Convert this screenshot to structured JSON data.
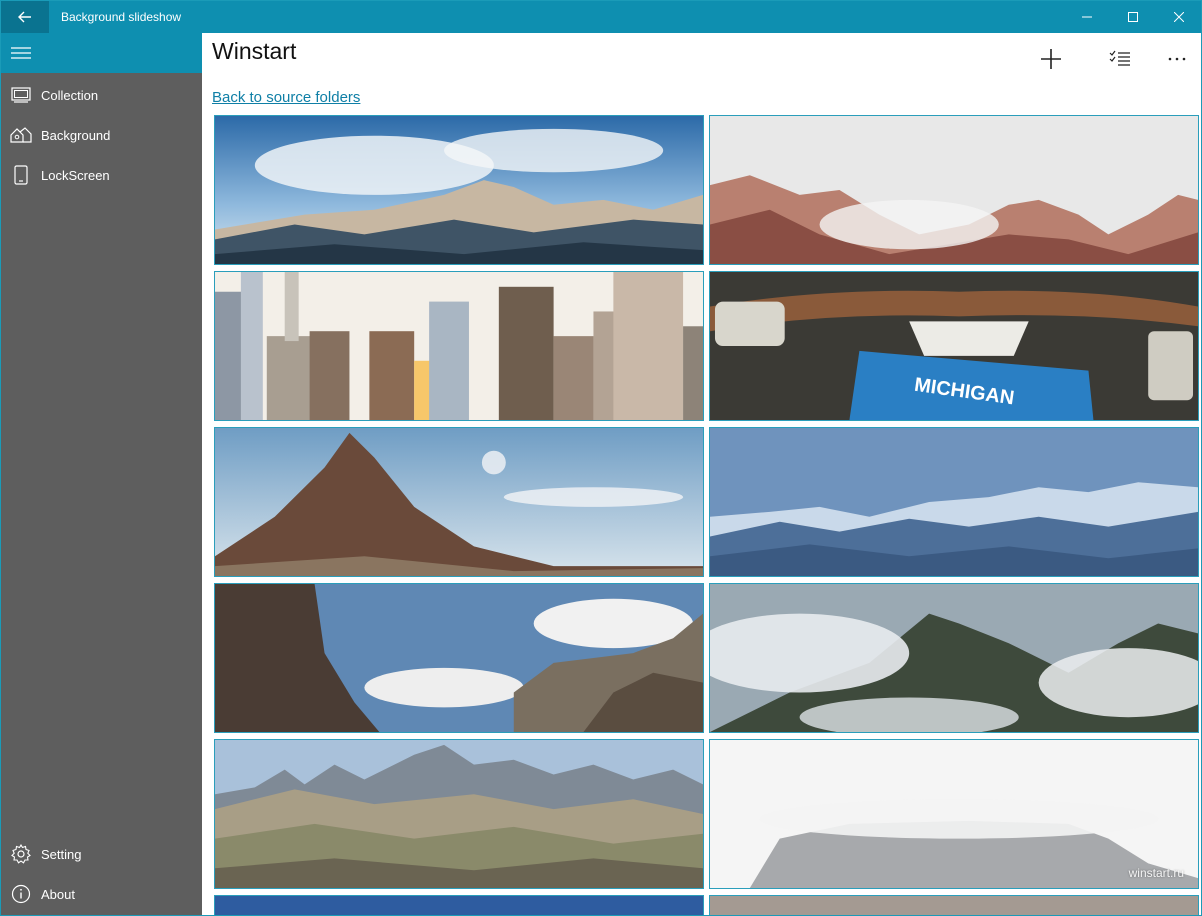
{
  "titlebar": {
    "title": "Background slideshow",
    "back_icon": "arrow-left-icon",
    "minimize_icon": "minimize-icon",
    "maximize_icon": "maximize-icon",
    "close_icon": "close-icon"
  },
  "sidebar": {
    "menu_icon": "hamburger-icon",
    "items": [
      {
        "label": "Collection",
        "icon": "collection-icon"
      },
      {
        "label": "Background",
        "icon": "background-icon"
      },
      {
        "label": "LockScreen",
        "icon": "phone-icon"
      }
    ],
    "footer_items": [
      {
        "label": "Setting",
        "icon": "gear-icon"
      },
      {
        "label": "About",
        "icon": "info-icon"
      }
    ]
  },
  "main": {
    "title": "Winstart",
    "back_link": "Back to source folders",
    "commands": [
      {
        "icon": "plus-icon"
      },
      {
        "icon": "select-list-icon"
      },
      {
        "icon": "more-icon"
      }
    ],
    "watermark": "winstart.ru",
    "images": [
      {
        "subject": "snowy mountains with blue sky and clouds"
      },
      {
        "subject": "red rock mountains in fog"
      },
      {
        "subject": "city skyscrapers at sunset"
      },
      {
        "subject": "rusty car with Michigan license plate",
        "plate_text": "MICHIGAN"
      },
      {
        "subject": "cone-shaped mountain with blue sky"
      },
      {
        "subject": "blue snowy mountain range"
      },
      {
        "subject": "rocky cliffs and clouds"
      },
      {
        "subject": "green forested mountain in clouds"
      },
      {
        "subject": "dolomites rocky peaks"
      },
      {
        "subject": "mountain covered in white fog"
      }
    ]
  },
  "colors": {
    "accent": "#0e8fb0",
    "accent_dark": "#0a7390",
    "sidebar_bg": "#5e5e5e",
    "link": "#0f7fa6",
    "tile_border": "#2a9ebb"
  }
}
